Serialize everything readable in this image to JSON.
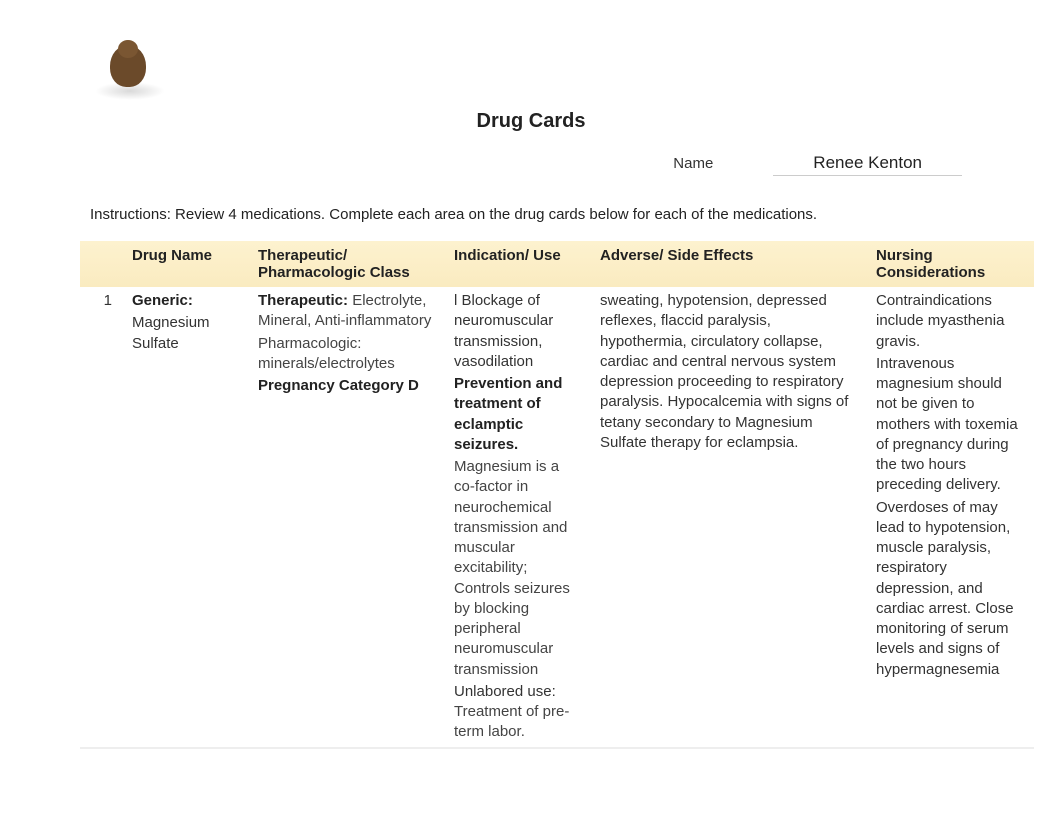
{
  "title": "Drug Cards",
  "name_label": "Name",
  "name_value": "Renee Kenton",
  "instructions": "Instructions: Review 4 medications.   Complete each area on the drug cards below for each of the medications.",
  "headers": {
    "num": "",
    "drug_name": "Drug Name",
    "class": "Therapeutic/ Pharmacologic Class",
    "indication": "Indication/ Use",
    "adverse": "Adverse/ Side Effects",
    "nursing": "Nursing Considerations"
  },
  "rows": [
    {
      "num": "1",
      "drug_name_label": "Generic:",
      "drug_name_value": "Magnesium Sulfate",
      "class_ther_label": "Therapeutic:",
      "class_ther_value": "Electrolyte, Mineral, Anti-inflammatory",
      "class_pharm_label": "Pharmacologic:",
      "class_pharm_value": "minerals/electrolytes",
      "class_preg": "Pregnancy Category D",
      "ind_block": "l Blockage of neuromuscular transmission, vasodilation",
      "ind_prev": "Prevention and treatment of eclamptic seizures.",
      "ind_mech": "Magnesium is a co-factor in neurochemical transmission and muscular excitability; Controls seizures by blocking peripheral neuromuscular transmission",
      "ind_unl_label": "Unlabored use:",
      "ind_unl_value": "Treatment of pre-term labor.",
      "adverse": "sweating, hypotension, depressed reflexes, flaccid paralysis, hypothermia, circulatory collapse, cardiac and central nervous system depression proceeding to respiratory paralysis. Hypocalcemia with signs of tetany secondary to Magnesium Sulfate therapy for eclampsia.",
      "nursing_a": "Contraindications include myasthenia gravis.",
      "nursing_b": "Intravenous magnesium should not be given to mothers with toxemia of pregnancy during the two hours preceding delivery.",
      "nursing_c": "Overdoses of may lead to hypotension, muscle paralysis, respiratory depression, and cardiac arrest. Close monitoring of serum levels and signs of hypermagnesemia"
    }
  ]
}
